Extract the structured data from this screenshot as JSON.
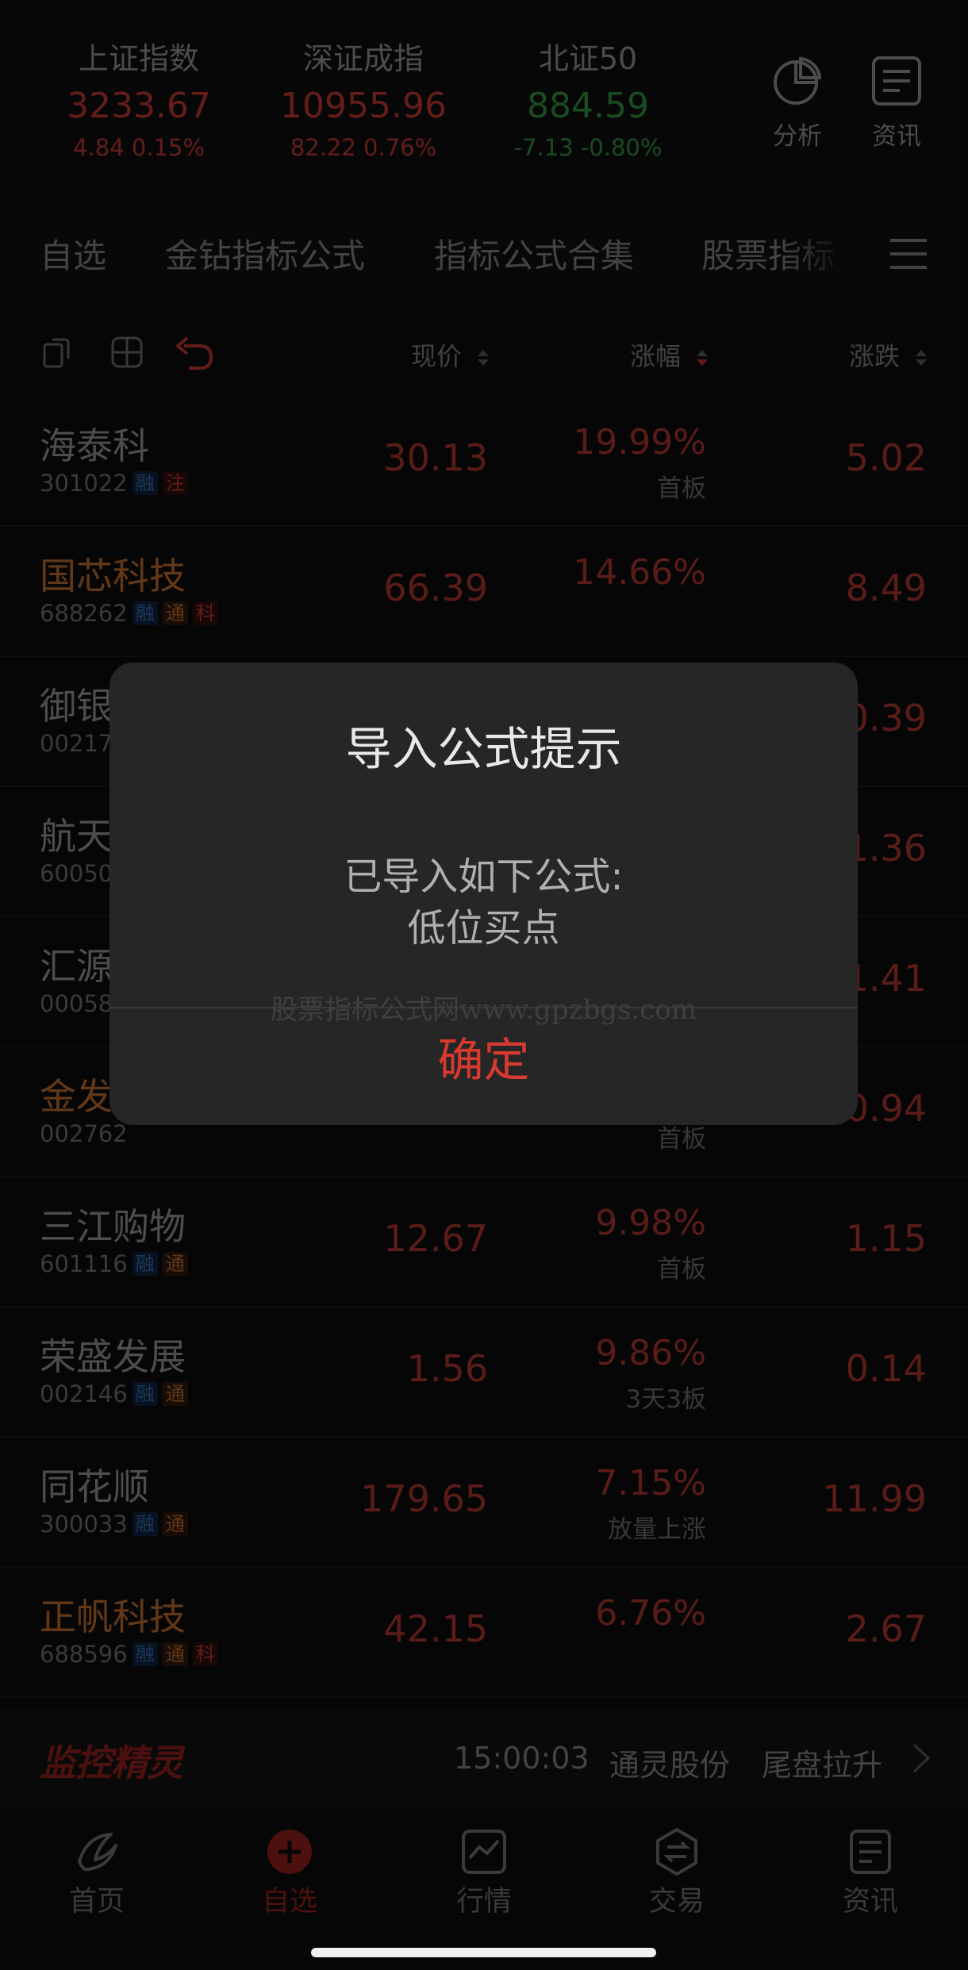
{
  "indices": [
    {
      "name": "上证指数",
      "price": "3233.67",
      "change": "4.84  0.15%"
    },
    {
      "name": "深证成指",
      "price": "10955.96",
      "change": "82.22  0.76%"
    },
    {
      "name": "北证50",
      "price": "884.59",
      "change": "-7.13  -0.80%"
    }
  ],
  "header_buttons": {
    "analysis": "分析",
    "news": "资讯"
  },
  "tabs": [
    "自选",
    "金钻指标公式",
    "指标公式合集",
    "股票指标"
  ],
  "columns": {
    "price": "现价",
    "pct": "涨幅",
    "change": "涨跌"
  },
  "stocks": [
    {
      "name": "海泰科",
      "code": "301022",
      "tags": [
        "融",
        "注"
      ],
      "price": "30.13",
      "pct": "19.99%",
      "note": "首板",
      "change": "5.02"
    },
    {
      "name": "国芯科技",
      "code": "688262",
      "tags": [
        "融",
        "通",
        "科"
      ],
      "price": "66.39",
      "pct": "14.66%",
      "note": "",
      "change": "8.49"
    },
    {
      "name": "御银",
      "code": "00217",
      "tags": [],
      "price": "",
      "pct": "",
      "note": "",
      "change": "0.39"
    },
    {
      "name": "航天",
      "code": "60050",
      "tags": [],
      "price": "",
      "pct": "",
      "note": "",
      "change": "1.36"
    },
    {
      "name": "汇源",
      "code": "00058",
      "tags": [],
      "price": "",
      "pct": "",
      "note": "",
      "change": "1.41"
    },
    {
      "name": "金发",
      "code": "002762",
      "tags": [],
      "price": "",
      "pct": "",
      "note": "首板",
      "change": "0.94"
    },
    {
      "name": "三江购物",
      "code": "601116",
      "tags": [
        "融",
        "通"
      ],
      "price": "12.67",
      "pct": "9.98%",
      "note": "首板",
      "change": "1.15"
    },
    {
      "name": "荣盛发展",
      "code": "002146",
      "tags": [
        "融",
        "通"
      ],
      "price": "1.56",
      "pct": "9.86%",
      "note": "3天3板",
      "change": "0.14"
    },
    {
      "name": "同花顺",
      "code": "300033",
      "tags": [
        "融",
        "通"
      ],
      "price": "179.65",
      "pct": "7.15%",
      "note": "放量上涨",
      "change": "11.99"
    },
    {
      "name": "正帆科技",
      "code": "688596",
      "tags": [
        "融",
        "通",
        "科"
      ],
      "price": "42.15",
      "pct": "6.76%",
      "note": "",
      "change": "2.67"
    }
  ],
  "monitor": {
    "logo": "监控精灵",
    "time": "15:00:03",
    "stock": "通灵股份",
    "event": "尾盘拉升"
  },
  "nav": [
    "首页",
    "自选",
    "行情",
    "交易",
    "资讯"
  ],
  "dialog": {
    "title": "导入公式提示",
    "message_line1": "已导入如下公式:",
    "message_line2": "低位买点",
    "watermark": "股票指标公式网www.gpzbgs.com",
    "confirm": "确定"
  },
  "colors": {
    "up": "#b8352e",
    "down": "#2f8a3d",
    "accent": "#d93a2f",
    "highlight_name": "#b5672a"
  },
  "icons": {
    "analysis": "pie-chart-icon",
    "news": "document-icon",
    "menu": "hamburger-menu-icon"
  }
}
